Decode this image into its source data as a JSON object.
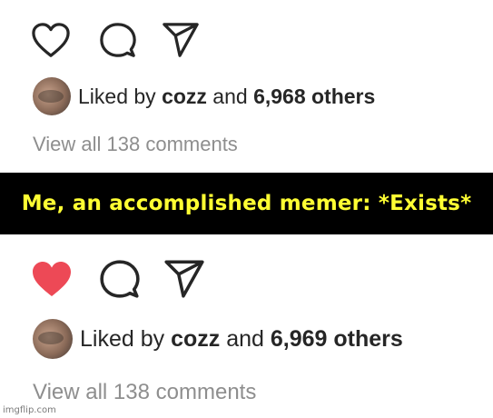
{
  "top_post": {
    "icons": [
      "heart-outline-icon",
      "comment-icon",
      "share-icon"
    ],
    "liked_by_prefix": "Liked by",
    "liked_by_user": "cozz",
    "liked_by_joiner": "and",
    "likes_count": "6,968 others",
    "comments_link": "View all 138 comments"
  },
  "caption": {
    "text": "Me, an accomplished memer: *Exists*",
    "text_color": "#ffff33",
    "background": "#000000"
  },
  "bottom_post": {
    "icons": [
      "heart-filled-icon",
      "comment-icon",
      "share-icon"
    ],
    "heart_color": "#ed4956",
    "liked_by_prefix": "Liked by",
    "liked_by_user": "cozz",
    "liked_by_joiner": "and",
    "likes_count": "6,969 others",
    "comments_link": "View all 138 comments"
  },
  "watermark": "imgflip.com"
}
